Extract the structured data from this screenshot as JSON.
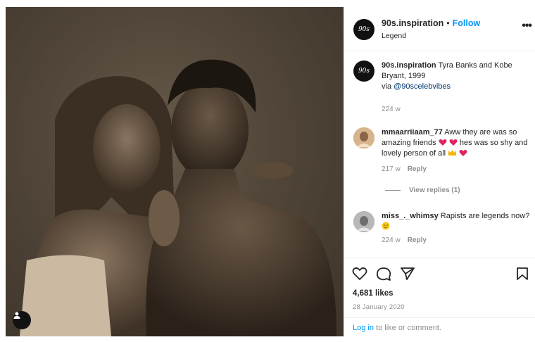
{
  "post": {
    "username": "90s.inspiration",
    "separator": "•",
    "follow_label": "Follow",
    "location": "Legend",
    "avatar_text": "90s",
    "more_label": "•••",
    "caption_text": "Tyra Banks and Kobe Bryant, 1999",
    "caption_via": "via",
    "caption_mention": "@90scelebvibes",
    "caption_time": "224 w"
  },
  "comments": [
    {
      "username": "mmaarriiaam_77",
      "text": "Aww they are was so amazing friends",
      "text2": "hes was so shy and lovely person of all",
      "time": "217 w",
      "reply_label": "Reply",
      "avatar_color": "#c9a27a"
    },
    {
      "username": "miss_._whimsy",
      "text": "Rapists are legends now?",
      "time": "224 w",
      "reply_label": "Reply",
      "avatar_color": "#9b9b9b"
    }
  ],
  "view_replies_label": "View replies (1)",
  "likes": "4,681 likes",
  "date": "28 January 2020",
  "login": {
    "link": "Log in",
    "rest": " to like or comment."
  },
  "colors": {
    "link_blue": "#0095f6",
    "mention_blue": "#00376b",
    "muted": "#8e8e8e",
    "heart_red": "#e0245e"
  },
  "icons": [
    "heart-icon",
    "comment-icon",
    "share-icon",
    "bookmark-icon",
    "user-tag-icon",
    "more-icon"
  ]
}
